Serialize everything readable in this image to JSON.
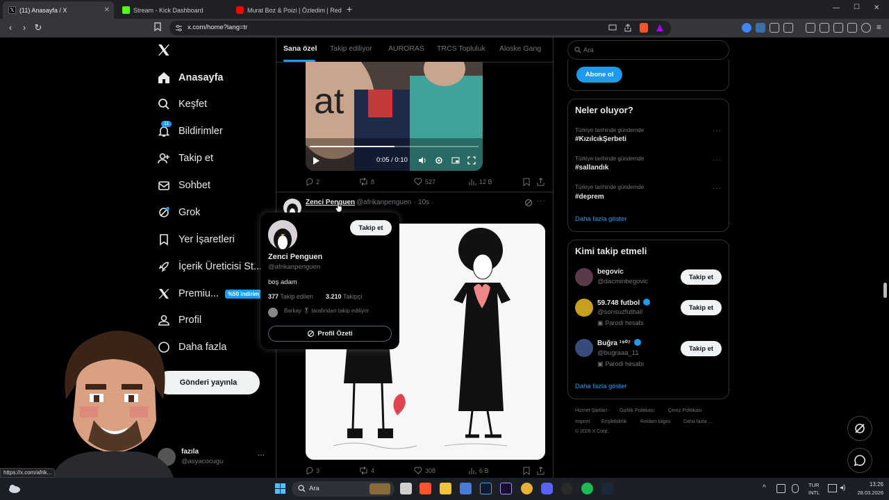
{
  "browser": {
    "tabs": [
      {
        "title": "(11) Anasayfa / X",
        "active": true
      },
      {
        "title": "Stream - Kick Dashboard",
        "active": false
      },
      {
        "title": "Murat Boz & Poizi | Özledim | Red Bu",
        "active": false
      }
    ],
    "new_tab": "+",
    "url": "x.com/home?lang=tr",
    "status_url": "https://x.com/afrik...",
    "window_controls": {
      "minimize": "—",
      "maximize": "☐",
      "close": "✕"
    }
  },
  "sidebar": {
    "items": [
      {
        "label": "Anasayfa",
        "icon": "home-icon"
      },
      {
        "label": "Keşfet",
        "icon": "search-icon"
      },
      {
        "label": "Bildirimler",
        "icon": "bell-icon",
        "badge": "11"
      },
      {
        "label": "Takip et",
        "icon": "person-add-icon"
      },
      {
        "label": "Sohbet",
        "icon": "mail-icon"
      },
      {
        "label": "Grok",
        "icon": "grok-icon"
      },
      {
        "label": "Yer İşaretleri",
        "icon": "bookmark-icon"
      },
      {
        "label": "İçerik Üreticisi St...",
        "icon": "rocket-icon"
      },
      {
        "label": "Premiu...",
        "icon": "x-logo-icon",
        "badge": "%50 indirim"
      },
      {
        "label": "Profil",
        "icon": "person-icon"
      },
      {
        "label": "Daha fazla",
        "icon": "more-icon"
      }
    ],
    "post_button": "Gönderi yayınla",
    "account": {
      "name": "fazıla",
      "handle": "@asyacocugu",
      "more": "···"
    }
  },
  "feed": {
    "tabs": [
      "Sana özel",
      "Takip ediliyor",
      "AURORAS",
      "TRCS Topluluk",
      "Aloske Gang"
    ],
    "video": {
      "overlay_text": "at",
      "time": "0:05 / 0:10",
      "progress": 0.5
    },
    "post1_actions": {
      "replies": "2",
      "reposts": "8",
      "likes": "527",
      "views": "12 B"
    },
    "post2": {
      "name": "Zenci Penguen",
      "handle": "@afrikanpenguen",
      "time": "· 10s",
      "actions": {
        "replies": "3",
        "reposts": "4",
        "likes": "308",
        "views": "6 B"
      }
    }
  },
  "hovercard": {
    "follow": "Takip et",
    "name": "Zenci Penguen",
    "handle": "@afrikanpenguen",
    "bio": "boş adam",
    "following_count": "377",
    "following_label": "Takip edilen",
    "followers_count": "3.210",
    "followers_label": "Takipçi",
    "followed_by": "Barkay 🎖 tarafından takip ediliyor",
    "profile_summary": "Profil Özeti"
  },
  "right": {
    "search_placeholder": "Ara",
    "subscribe": "Abone ol",
    "trends_title": "Neler oluyor?",
    "trends": [
      {
        "meta": "Türkiye tarihinde gündemde",
        "tag": "#KızılcıkŞerbeti"
      },
      {
        "meta": "Türkiye tarihinde gündemde",
        "tag": "#sallandık"
      },
      {
        "meta": "Türkiye tarihinde gündemde",
        "tag": "#deprem"
      }
    ],
    "trends_more": "Daha fazla göster",
    "who_title": "Kimi takip etmeli",
    "who": [
      {
        "name": "begovic",
        "handle": "@dacminbegovic",
        "sub": "",
        "button": "Takip et"
      },
      {
        "name": "59.748 futbol",
        "handle": "@sonsuzfutball",
        "sub": "Parodi hesabı",
        "button": "Takip et"
      },
      {
        "name": "Buğra ¹⁹⁰⁷",
        "handle": "@bugraaa_11",
        "sub": "Parodi hesabı",
        "button": "Takip et"
      }
    ],
    "who_more": "Daha fazla göster",
    "footer_links": [
      "Hizmet Şartları",
      "Gizlilik Politikası",
      "Çerez Politikası",
      "Imprint",
      "Erişilebilirlik",
      "Reklam bilgisi",
      "Daha fazla ..."
    ],
    "copyright": "© 2026 X Corp."
  },
  "taskbar": {
    "search": "Ara",
    "lang": "TUR",
    "lang2": "INTL",
    "time": "13:26",
    "date": "28.03.2026"
  },
  "colors": {
    "accent": "#1d9bf0",
    "bg": "#000000",
    "border": "#2f3336",
    "muted": "#71767b"
  }
}
